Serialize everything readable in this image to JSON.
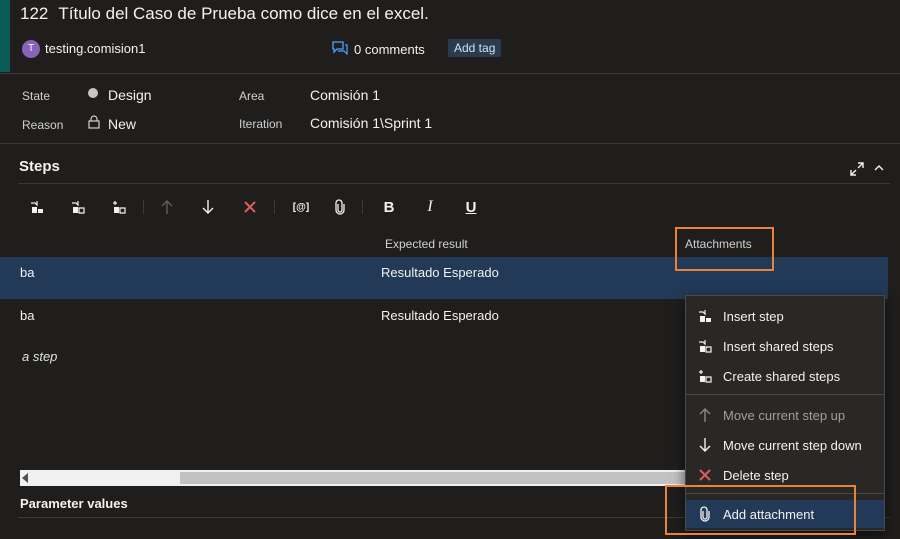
{
  "work_item": {
    "id": "122",
    "title": "Título del Caso de Prueba como dice en el excel.",
    "user_initial": "T",
    "user_name": "testing.comision1",
    "comments": "0 comments",
    "add_tag": "Add tag"
  },
  "fields": {
    "state_label": "State",
    "state_value": "Design",
    "reason_label": "Reason",
    "reason_value": "New",
    "area_label": "Area",
    "area_value": "Comisión 1",
    "iteration_label": "Iteration",
    "iteration_value": "Comisión 1\\Sprint 1"
  },
  "steps": {
    "title": "Steps",
    "columns": {
      "expected": "Expected result",
      "attachments": "Attachments"
    },
    "rows": [
      {
        "action": "ba",
        "expected": "Resultado Esperado"
      },
      {
        "action": "ba",
        "expected": "Resultado Esperado"
      }
    ],
    "add_step": "a step"
  },
  "toolbar": {
    "bold": "B",
    "italic": "I",
    "underline": "U",
    "param": "[@]"
  },
  "parameters": {
    "title": "Parameter values"
  },
  "context_menu": {
    "items": [
      {
        "label": "Insert step",
        "icon": "insert-step-icon"
      },
      {
        "label": "Insert shared steps",
        "icon": "insert-shared-steps-icon"
      },
      {
        "label": "Create shared steps",
        "icon": "create-shared-steps-icon"
      },
      {
        "label": "Move current step up",
        "icon": "arrow-up-icon",
        "disabled": true
      },
      {
        "label": "Move current step down",
        "icon": "arrow-down-icon"
      },
      {
        "label": "Delete step",
        "icon": "delete-x-icon"
      },
      {
        "label": "Add attachment",
        "icon": "paperclip-icon",
        "active": true
      }
    ]
  },
  "colors": {
    "background": "#1f1e1d",
    "accent": "#0a5a55",
    "selection": "#223a57",
    "highlight_box": "#e8833a",
    "delete": "#e05c5c"
  }
}
